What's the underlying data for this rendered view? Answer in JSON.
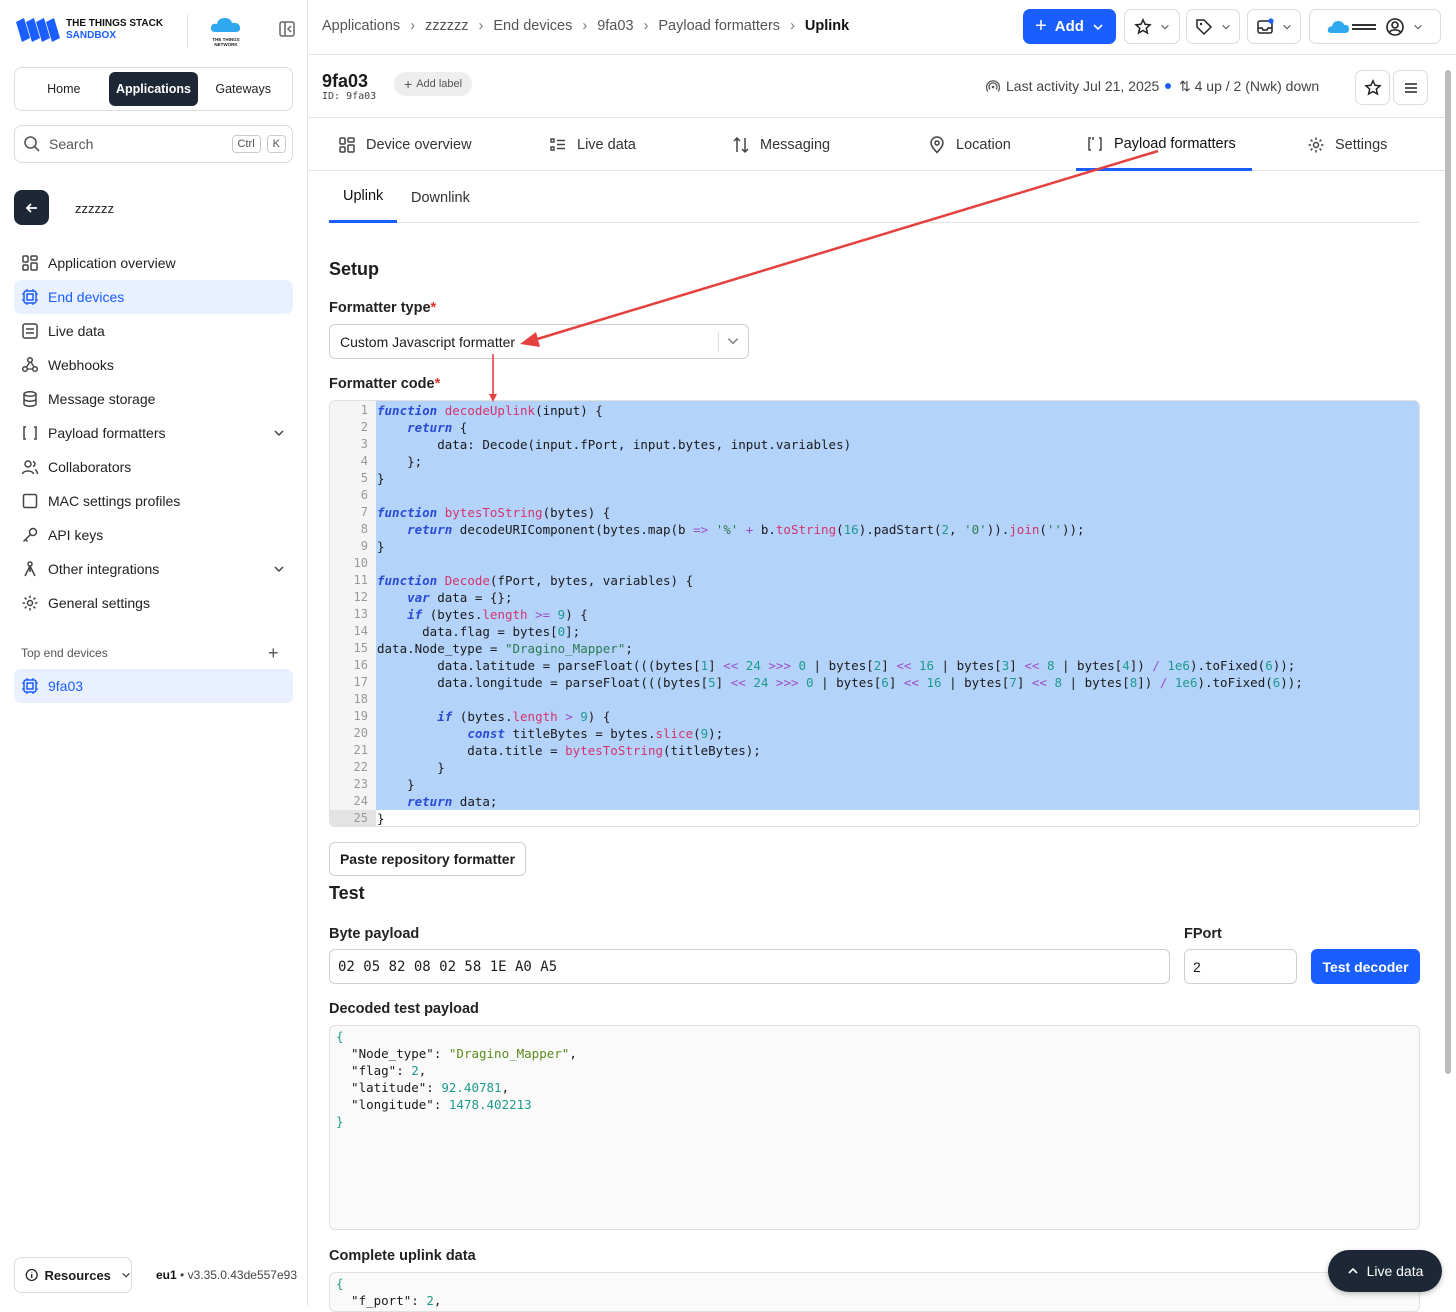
{
  "brand": {
    "line1": "THE THINGS STACK",
    "line2": "SANDBOX",
    "ttn": "THE THINGS NETWORK"
  },
  "sidebar": {
    "tabs": [
      {
        "label": "Home"
      },
      {
        "label": "Applications",
        "active": true
      },
      {
        "label": "Gateways"
      }
    ],
    "search": {
      "placeholder": "Search",
      "kbd1": "Ctrl",
      "kbd2": "K"
    },
    "app_name": "zzzzzz",
    "items": [
      {
        "label": "Application overview",
        "icon": "grid-icon"
      },
      {
        "label": "End devices",
        "icon": "chip-icon",
        "active": true
      },
      {
        "label": "Live data",
        "icon": "list-icon"
      },
      {
        "label": "Webhooks",
        "icon": "webhook-icon"
      },
      {
        "label": "Message storage",
        "icon": "database-icon"
      },
      {
        "label": "Payload formatters",
        "icon": "code-icon",
        "expandable": true
      },
      {
        "label": "Collaborators",
        "icon": "users-icon"
      },
      {
        "label": "MAC settings profiles",
        "icon": "square-icon"
      },
      {
        "label": "API keys",
        "icon": "key-icon"
      },
      {
        "label": "Other integrations",
        "icon": "integration-icon",
        "expandable": true
      },
      {
        "label": "General settings",
        "icon": "gear-icon"
      }
    ],
    "top_devices_label": "Top end devices",
    "top_device": "9fa03",
    "resources": "Resources",
    "cluster": "eu1",
    "version": "v3.35.0.43de557e93"
  },
  "header": {
    "breadcrumbs": [
      "Applications",
      "zzzzzz",
      "End devices",
      "9fa03",
      "Payload formatters",
      "Uplink"
    ],
    "add_label": "Add",
    "accent": "#1a5eff"
  },
  "device": {
    "name": "9fa03",
    "id": "ID: 9fa03",
    "add_label": "Add label",
    "last_activity": "Last activity Jul 21, 2025",
    "traffic": "4 up / 2 (Nwk) down"
  },
  "tabs": [
    "Device overview",
    "Live data",
    "Messaging",
    "Location",
    "Payload formatters",
    "Settings"
  ],
  "subtabs": [
    "Uplink",
    "Downlink"
  ],
  "setup": {
    "title": "Setup",
    "formatter_type_label": "Formatter type",
    "formatter_type_value": "Custom Javascript formatter",
    "formatter_code_label": "Formatter code",
    "paste_button": "Paste repository formatter"
  },
  "code_lines": [
    "function decodeUplink(input) {",
    "    return {",
    "        data: Decode(input.fPort, input.bytes, input.variables)",
    "    };",
    "}",
    "",
    "function bytesToString(bytes) {",
    "    return decodeURIComponent(bytes.map(b => '%' + b.toString(16).padStart(2, '0')).join(''));",
    "}",
    "",
    "function Decode(fPort, bytes, variables) {",
    "    var data = {};",
    "    if (bytes.length >= 9) {",
    "      data.flag = bytes[0];",
    "data.Node_type = \"Dragino_Mapper\";",
    "        data.latitude = parseFloat(((bytes[1] << 24 >>> 0 | bytes[2] << 16 | bytes[3] << 8 | bytes[4]) / 1e6).toFixed(6));",
    "        data.longitude = parseFloat(((bytes[5] << 24 >>> 0 | bytes[6] << 16 | bytes[7] << 8 | bytes[8]) / 1e6).toFixed(6));",
    "",
    "        if (bytes.length > 9) {",
    "            const titleBytes = bytes.slice(9);",
    "            data.title = bytesToString(titleBytes);",
    "        }",
    "    }",
    "    return data;",
    "}"
  ],
  "test": {
    "title": "Test",
    "byte_payload_label": "Byte payload",
    "byte_payload_value": "02 05 82 08 02 58 1E A0 A5",
    "fport_label": "FPort",
    "fport_value": "2",
    "test_button": "Test decoder",
    "decoded_label": "Decoded test payload",
    "decoded": [
      {
        "t": "{"
      },
      {
        "k": "\"Node_type\"",
        "v": "\"Dragino_Mapper\"",
        "vt": "str",
        "c": ","
      },
      {
        "k": "\"flag\"",
        "v": "2",
        "vt": "num",
        "c": ","
      },
      {
        "k": "\"latitude\"",
        "v": "92.40781",
        "vt": "num",
        "c": ","
      },
      {
        "k": "\"longitude\"",
        "v": "1478.402213",
        "vt": "num",
        "c": ""
      },
      {
        "t": "}"
      }
    ],
    "complete_label": "Complete uplink data",
    "complete": [
      {
        "t": "{"
      },
      {
        "k": "\"f_port\"",
        "v": "2",
        "vt": "num",
        "c": ","
      }
    ]
  },
  "live_data_button": "Live data"
}
